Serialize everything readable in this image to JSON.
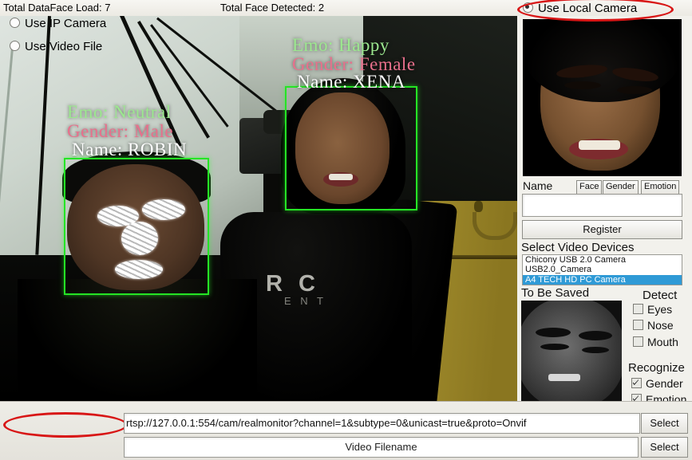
{
  "status": {
    "total_dataface_load": "Total DataFace Load: 7",
    "total_face_detected": "Total Face Detected: 2"
  },
  "source_select": {
    "local_camera_label": "Use Local Camera",
    "local_camera_selected": true,
    "ip_camera_label": "Use IP Camera",
    "ip_camera_selected": false,
    "video_file_label": "Use Video File",
    "video_file_selected": false,
    "ip_url_value": "rtsp://127.0.0.1:554/cam/realmonitor?channel=1&subtype=0&unicast=true&proto=Onvif",
    "video_file_placeholder": "Video Filename",
    "select_button_1": "Select",
    "select_button_2": "Select",
    "highlight_color": "#d81616"
  },
  "video_overlay": {
    "faces": [
      {
        "emotion": "Emo: Neutral",
        "gender": "Gender: Male",
        "name": "Name: ROBIN",
        "box_color": "#25e425"
      },
      {
        "emotion": "Emo: Happy",
        "gender": "Gender: Female",
        "name": "Name: XENA",
        "box_color": "#25e425"
      }
    ],
    "emotion_text_color": "#9ce88f",
    "gender_text_color": "#e8708c",
    "name_text_color": "#ffffff"
  },
  "right_panel": {
    "name_label": "Name",
    "name_value": "",
    "attribute_buttons": [
      "Face",
      "Gender",
      "Emotion"
    ],
    "register_button": "Register",
    "devices_label": "Select Video Devices",
    "devices": [
      {
        "label": "Chicony USB 2.0 Camera",
        "selected": false
      },
      {
        "label": "USB2.0_Camera",
        "selected": false
      },
      {
        "label": "A4 TECH HD PC Camera",
        "selected": true
      }
    ],
    "device_selected_color": "#2f9ad6",
    "to_be_saved_label": "To Be Saved",
    "detect_label": "Detect",
    "detect_options": [
      {
        "label": "Eyes",
        "checked": false
      },
      {
        "label": "Nose",
        "checked": false
      },
      {
        "label": "Mouth",
        "checked": false
      }
    ],
    "recognize_label": "Recognize",
    "recognize_options": [
      {
        "label": "Gender",
        "checked": true
      },
      {
        "label": "Emotion",
        "checked": true
      }
    ]
  }
}
